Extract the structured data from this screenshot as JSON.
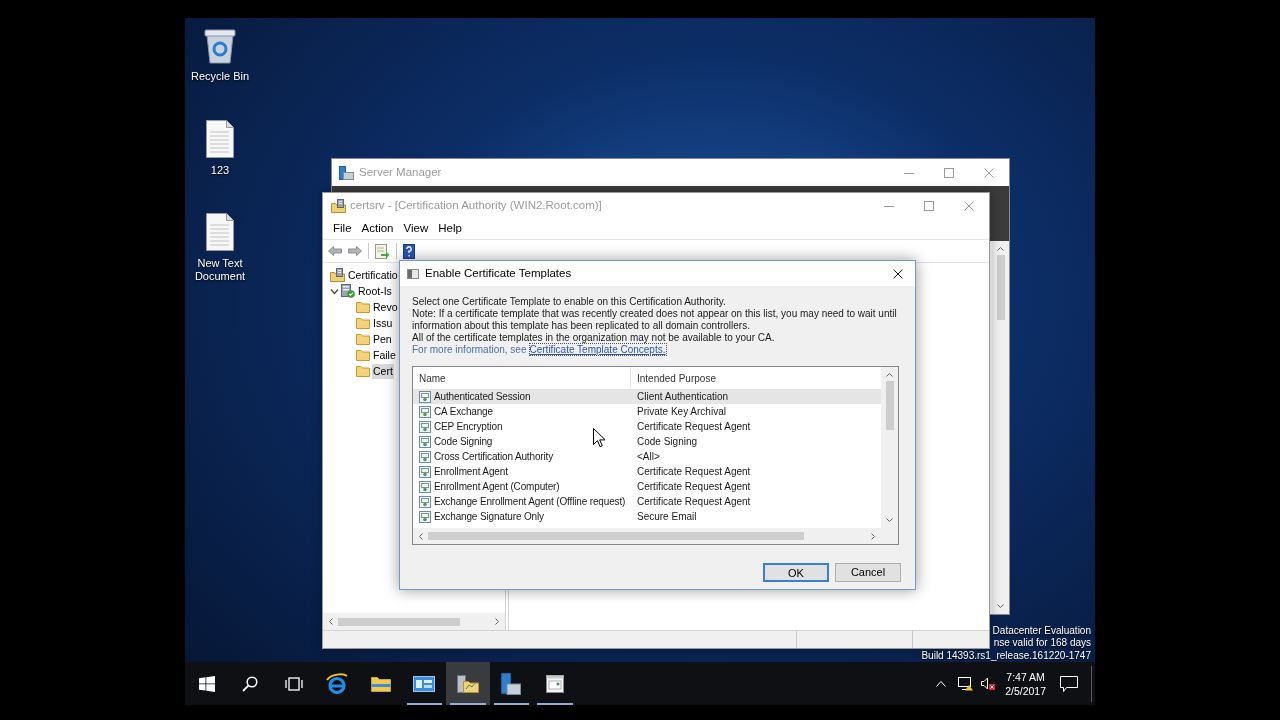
{
  "desktop": {
    "icons": [
      {
        "kind": "recycle_bin",
        "label": "Recycle Bin"
      },
      {
        "kind": "text_file",
        "label": "123"
      },
      {
        "kind": "text_file",
        "label": "New Text Document"
      }
    ],
    "evaluation_notice": [
      "Datacenter Evaluation",
      "nse valid for 168 days",
      "Build 14393.rs1_release.161220-1747"
    ]
  },
  "server_manager": {
    "title": "Server Manager"
  },
  "certsrv": {
    "title": "certsrv - [Certification Authority (WIN2.Root.com)]",
    "menu": [
      "File",
      "Action",
      "View",
      "Help"
    ],
    "tree": [
      {
        "kind": "snap_in",
        "label": "Certificatio",
        "selected": false,
        "children": [
          {
            "kind": "ca",
            "label": "Root-Is",
            "selected": false,
            "expanded": true,
            "children": [
              {
                "kind": "folder",
                "label": "Revo",
                "selected": false
              },
              {
                "kind": "folder",
                "label": "Issu",
                "selected": false
              },
              {
                "kind": "folder",
                "label": "Pen",
                "selected": false
              },
              {
                "kind": "folder",
                "label": "Faile",
                "selected": false
              },
              {
                "kind": "folder",
                "label": "Cert",
                "selected": true
              }
            ]
          }
        ]
      }
    ]
  },
  "dialog": {
    "title": "Enable Certificate Templates",
    "intro": [
      "Select one Certificate Template to enable on this Certification Authority.",
      "Note: If a certificate template that was recently created does not appear on this list, you may need to wait until information about this template has been replicated to all domain controllers.",
      "All of the certificate templates in the organization may not be available to your CA."
    ],
    "more_info": {
      "text": "For more information, see",
      "link": "Certificate Template Concepts."
    },
    "table": {
      "columns": [
        "Name",
        "Intended Purpose"
      ],
      "rows": [
        {
          "name": "Authenticated Session",
          "purpose": "Client Authentication",
          "selected": true
        },
        {
          "name": "CA Exchange",
          "purpose": "Private Key Archival",
          "selected": false
        },
        {
          "name": "CEP Encryption",
          "purpose": "Certificate Request Agent",
          "selected": false
        },
        {
          "name": "Code Signing",
          "purpose": "Code Signing",
          "selected": false
        },
        {
          "name": "Cross Certification Authority",
          "purpose": "<All>",
          "selected": false
        },
        {
          "name": "Enrollment Agent",
          "purpose": "Certificate Request Agent",
          "selected": false
        },
        {
          "name": "Enrollment Agent (Computer)",
          "purpose": "Certificate Request Agent",
          "selected": false
        },
        {
          "name": "Exchange Enrollment Agent (Offline request)",
          "purpose": "Certificate Request Agent",
          "selected": false
        },
        {
          "name": "Exchange Signature Only",
          "purpose": "Secure Email",
          "selected": false
        }
      ]
    },
    "buttons": [
      {
        "label": "OK",
        "default": true
      },
      {
        "label": "Cancel",
        "default": false
      }
    ]
  },
  "taskbar": {
    "apps": [
      {
        "kind": "start"
      },
      {
        "kind": "search"
      },
      {
        "kind": "task_view"
      },
      {
        "kind": "browser",
        "running": false,
        "active": false
      },
      {
        "kind": "file_explorer",
        "running": false,
        "active": false
      },
      {
        "kind": "console",
        "running": true,
        "active": false
      },
      {
        "kind": "cert_authority",
        "running": true,
        "active": true
      },
      {
        "kind": "server_manager",
        "running": true,
        "active": false
      },
      {
        "kind": "notepad",
        "running": true,
        "active": false
      }
    ],
    "clock": {
      "time": "7:47 AM",
      "date": "2/5/2017"
    }
  }
}
